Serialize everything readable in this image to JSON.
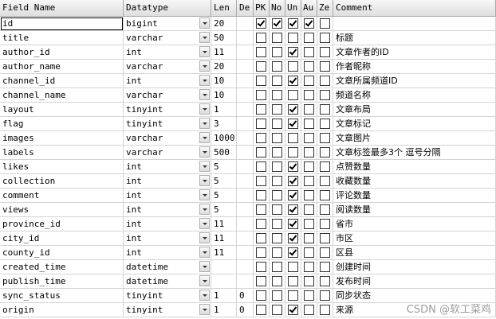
{
  "headers": [
    "Field Name",
    "Datatype",
    "Len",
    "De",
    "PK",
    "No",
    "Un",
    "Au",
    "Ze",
    "Comment"
  ],
  "rows": [
    {
      "name": "id",
      "type": "bigint",
      "len": "20",
      "def": "",
      "pk": true,
      "notnull": true,
      "un": true,
      "ai": true,
      "zf": false,
      "comment": ""
    },
    {
      "name": "title",
      "type": "varchar",
      "len": "50",
      "def": "",
      "pk": false,
      "notnull": false,
      "un": false,
      "ai": false,
      "zf": false,
      "comment": "标题"
    },
    {
      "name": "author_id",
      "type": "int",
      "len": "11",
      "def": "",
      "pk": false,
      "notnull": false,
      "un": true,
      "ai": false,
      "zf": false,
      "comment": "文章作者的ID"
    },
    {
      "name": "author_name",
      "type": "varchar",
      "len": "20",
      "def": "",
      "pk": false,
      "notnull": false,
      "un": false,
      "ai": false,
      "zf": false,
      "comment": "作者昵称"
    },
    {
      "name": "channel_id",
      "type": "int",
      "len": "10",
      "def": "",
      "pk": false,
      "notnull": false,
      "un": true,
      "ai": false,
      "zf": false,
      "comment": "文章所属频道ID"
    },
    {
      "name": "channel_name",
      "type": "varchar",
      "len": "10",
      "def": "",
      "pk": false,
      "notnull": false,
      "un": false,
      "ai": false,
      "zf": false,
      "comment": "频道名称"
    },
    {
      "name": "layout",
      "type": "tinyint",
      "len": "1",
      "def": "",
      "pk": false,
      "notnull": false,
      "un": true,
      "ai": false,
      "zf": false,
      "comment": "文章布局"
    },
    {
      "name": "flag",
      "type": "tinyint",
      "len": "3",
      "def": "",
      "pk": false,
      "notnull": false,
      "un": true,
      "ai": false,
      "zf": false,
      "comment": "文章标记"
    },
    {
      "name": "images",
      "type": "varchar",
      "len": "1000",
      "def": "",
      "pk": false,
      "notnull": false,
      "un": false,
      "ai": false,
      "zf": false,
      "comment": "文章图片"
    },
    {
      "name": "labels",
      "type": "varchar",
      "len": "500",
      "def": "",
      "pk": false,
      "notnull": false,
      "un": false,
      "ai": false,
      "zf": false,
      "comment": "文章标签最多3个 逗号分隔"
    },
    {
      "name": "likes",
      "type": "int",
      "len": "5",
      "def": "",
      "pk": false,
      "notnull": false,
      "un": true,
      "ai": false,
      "zf": false,
      "comment": "点赞数量"
    },
    {
      "name": "collection",
      "type": "int",
      "len": "5",
      "def": "",
      "pk": false,
      "notnull": false,
      "un": true,
      "ai": false,
      "zf": false,
      "comment": "收藏数量"
    },
    {
      "name": "comment",
      "type": "int",
      "len": "5",
      "def": "",
      "pk": false,
      "notnull": false,
      "un": true,
      "ai": false,
      "zf": false,
      "comment": "评论数量"
    },
    {
      "name": "views",
      "type": "int",
      "len": "5",
      "def": "",
      "pk": false,
      "notnull": false,
      "un": true,
      "ai": false,
      "zf": false,
      "comment": "阅读数量"
    },
    {
      "name": "province_id",
      "type": "int",
      "len": "11",
      "def": "",
      "pk": false,
      "notnull": false,
      "un": true,
      "ai": false,
      "zf": false,
      "comment": "省市"
    },
    {
      "name": "city_id",
      "type": "int",
      "len": "11",
      "def": "",
      "pk": false,
      "notnull": false,
      "un": true,
      "ai": false,
      "zf": false,
      "comment": "市区"
    },
    {
      "name": "county_id",
      "type": "int",
      "len": "11",
      "def": "",
      "pk": false,
      "notnull": false,
      "un": true,
      "ai": false,
      "zf": false,
      "comment": "区县"
    },
    {
      "name": "created_time",
      "type": "datetime",
      "len": "",
      "def": "",
      "pk": false,
      "notnull": false,
      "un": false,
      "ai": false,
      "zf": false,
      "comment": "创建时间"
    },
    {
      "name": "publish_time",
      "type": "datetime",
      "len": "",
      "def": "",
      "pk": false,
      "notnull": false,
      "un": false,
      "ai": false,
      "zf": false,
      "comment": "发布时间"
    },
    {
      "name": "sync_status",
      "type": "tinyint",
      "len": "1",
      "def": "0",
      "pk": false,
      "notnull": false,
      "un": false,
      "ai": false,
      "zf": false,
      "comment": "同步状态"
    },
    {
      "name": "origin",
      "type": "tinyint",
      "len": "1",
      "def": "0",
      "pk": false,
      "notnull": false,
      "un": true,
      "ai": false,
      "zf": false,
      "comment": "来源"
    }
  ],
  "watermark": "CSDN @软工菜鸡"
}
